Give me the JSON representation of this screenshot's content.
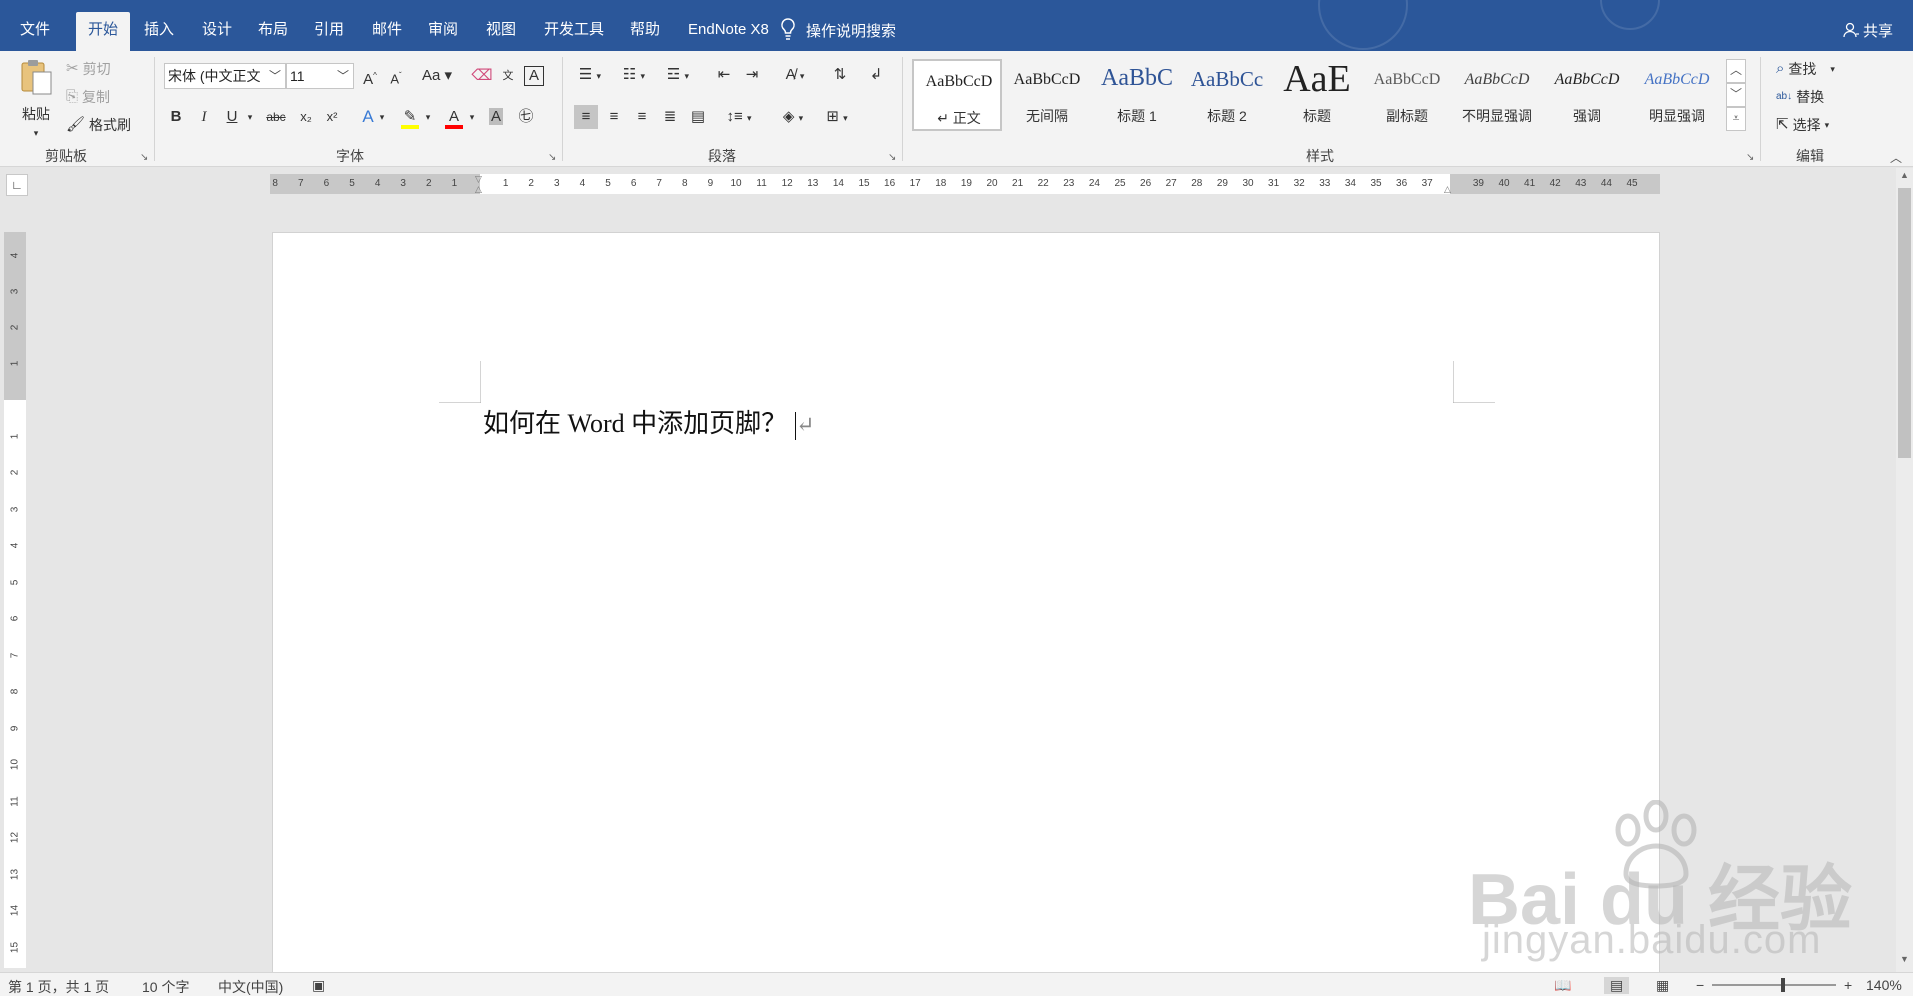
{
  "tabs": [
    {
      "label": "文件"
    },
    {
      "label": "开始"
    },
    {
      "label": "插入"
    },
    {
      "label": "设计"
    },
    {
      "label": "布局"
    },
    {
      "label": "引用"
    },
    {
      "label": "邮件"
    },
    {
      "label": "审阅"
    },
    {
      "label": "视图"
    },
    {
      "label": "开发工具"
    },
    {
      "label": "帮助"
    },
    {
      "label": "EndNote X8"
    }
  ],
  "tellme": "操作说明搜索",
  "share": "共享",
  "clipboard": {
    "paste": "粘贴",
    "cut": "剪切",
    "copy": "复制",
    "format_painter": "格式刷",
    "label": "剪贴板"
  },
  "font": {
    "name": "宋体 (中文正文",
    "size": "11",
    "label": "字体",
    "bold": "B",
    "italic": "I",
    "underline": "U",
    "strike": "abc",
    "subscript": "x₂",
    "superscript": "x²",
    "case": "Aa",
    "grow": "A",
    "shrink": "A",
    "font_color": "A",
    "shade": "A"
  },
  "paragraph": {
    "label": "段落"
  },
  "styles": {
    "label": "样式",
    "items": [
      {
        "preview": "AaBbCcD",
        "name": "↵ 正文"
      },
      {
        "preview": "AaBbCcD",
        "name": "无间隔"
      },
      {
        "preview": "AaBbC",
        "name": "标题 1"
      },
      {
        "preview": "AaBbCc",
        "name": "标题 2"
      },
      {
        "preview": "AaE",
        "name": "标题"
      },
      {
        "preview": "AaBbCcD",
        "name": "副标题"
      },
      {
        "preview": "AaBbCcD",
        "name": "不明显强调"
      },
      {
        "preview": "AaBbCcD",
        "name": "强调"
      },
      {
        "preview": "AaBbCcD",
        "name": "明显强调"
      }
    ]
  },
  "editing": {
    "label": "编辑",
    "find": "查找",
    "replace": "替换",
    "select": "选择"
  },
  "ruler": {
    "left_nums": [
      "8",
      "7",
      "6",
      "5",
      "4",
      "3",
      "2",
      "1"
    ],
    "nums": [
      "1",
      "2",
      "3",
      "4",
      "5",
      "6",
      "7",
      "8",
      "9",
      "10",
      "11",
      "12",
      "13",
      "14",
      "15",
      "16",
      "17",
      "18",
      "19",
      "20",
      "21",
      "22",
      "23",
      "24",
      "25",
      "26",
      "27",
      "28",
      "29",
      "30",
      "31",
      "32",
      "33",
      "34",
      "35",
      "36",
      "37",
      "39",
      "40",
      "41",
      "42",
      "43",
      "44",
      "45"
    ],
    "vnums": [
      "4",
      "3",
      "2",
      "1",
      "1",
      "2",
      "3",
      "4",
      "5",
      "6",
      "7",
      "8",
      "9",
      "10",
      "11",
      "12",
      "13",
      "14",
      "15"
    ]
  },
  "document": {
    "text": "如何在 Word 中添加页脚？",
    "pilcrow": "↵"
  },
  "status": {
    "page": "第 1 页，共 1 页",
    "words": "10 个字",
    "language": "中文(中国)",
    "zoom": "140%",
    "zoom_level": 0.57
  },
  "watermark": {
    "brand": "Bai du 经验",
    "url": "jingyan.baidu.com"
  },
  "colors": {
    "accent": "#2b579a",
    "highlight": "#ffff00",
    "font_color": "#ff0000"
  }
}
